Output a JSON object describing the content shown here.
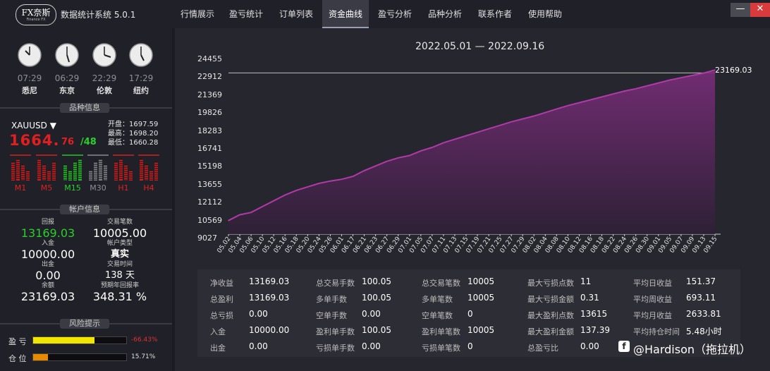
{
  "app": {
    "logo_main": "FX奈斯",
    "logo_sub": "Finance FX",
    "title": "数据统计系统 5.0.1"
  },
  "nav": {
    "tabs": [
      "行情展示",
      "盈亏统计",
      "订单列表",
      "资金曲线",
      "盈亏分析",
      "品种分析",
      "联系作者",
      "使用帮助"
    ],
    "active": 3
  },
  "window": {
    "minimize": "—",
    "close": "✕"
  },
  "clocks": [
    {
      "time": "07:29",
      "city": "悉尼"
    },
    {
      "time": "06:29",
      "city": "东京"
    },
    {
      "time": "22:29",
      "city": "伦敦"
    },
    {
      "time": "17:29",
      "city": "纽约"
    }
  ],
  "instrument": {
    "section_title": "品种信息",
    "symbol": "XAUUSD",
    "price_main": "1664.",
    "price_frac": "76",
    "price_sep": "/48",
    "open": "开盘：1697.59",
    "high": "最高：1698.20",
    "low": "最低：1660.28",
    "timeframes": [
      {
        "label": "M1",
        "color": "#e02020"
      },
      {
        "label": "M5",
        "color": "#e02020"
      },
      {
        "label": "M15",
        "color": "#2ad02a"
      },
      {
        "label": "M30",
        "color": "#8f8f96"
      },
      {
        "label": "H1",
        "color": "#e02020"
      },
      {
        "label": "H4",
        "color": "#e02020"
      }
    ]
  },
  "account": {
    "section_title": "帐户信息",
    "return_label": "回报",
    "return_value": "13169.03",
    "deposit_label": "入金",
    "deposit_value": "10000.00",
    "withdraw_label": "出金",
    "withdraw_value": "0.00",
    "balance_label": "余额",
    "balance_value": "23169.03",
    "trades_label": "交易笔数",
    "trades_value": "10005.00",
    "type_label": "帐户类型",
    "type_value": "真实",
    "time_label": "交易时间",
    "time_value": "138 天",
    "annual_label": "预期年回报率",
    "annual_value": "348.31 %"
  },
  "risk": {
    "section_title": "风险提示",
    "pl_label": "盈 亏",
    "pl_value": "-66.43%",
    "pl_fill": 0.66,
    "pl_color": "#f2e600",
    "pl_text_color": "#e03030",
    "pos_label": "仓 位",
    "pos_value": "15.71%",
    "pos_fill": 0.157,
    "pos_color": "#e88a00",
    "pos_text_color": "#e0e0e0"
  },
  "chart_data": {
    "type": "area",
    "title": "2022.05.01 — 2022.09.16",
    "y_ticks": [
      "24455",
      "22912",
      "21369",
      "19826",
      "18283",
      "16741",
      "15198",
      "13655",
      "12112",
      "10569",
      "9027"
    ],
    "ylim": [
      9027,
      24455
    ],
    "x_ticks": [
      "05.02",
      "05.04",
      "05.06",
      "05.10",
      "05.12",
      "05.16",
      "05.18",
      "05.20",
      "05.24",
      "05.26",
      "06.01",
      "06.17",
      "06.21",
      "06.23",
      "06.27",
      "06.29",
      "07.01",
      "07.05",
      "07.07",
      "07.11",
      "07.13",
      "07.15",
      "07.19",
      "07.21",
      "07.25",
      "07.27",
      "07.29",
      "08.02",
      "08.04",
      "08.08",
      "08.10",
      "08.12",
      "08.16",
      "08.18",
      "08.22",
      "08.24",
      "08.26",
      "08.30",
      "09.01",
      "09.05",
      "09.07",
      "09.09",
      "09.13",
      "09.15"
    ],
    "values": [
      10200,
      10700,
      10900,
      11400,
      11900,
      12400,
      12800,
      13100,
      13400,
      13600,
      13750,
      14000,
      14500,
      14900,
      15300,
      15600,
      15800,
      16200,
      16500,
      16900,
      17200,
      17500,
      17800,
      18100,
      18400,
      18700,
      18950,
      19200,
      19500,
      19800,
      20100,
      20350,
      20600,
      20850,
      21100,
      21350,
      21550,
      21800,
      22050,
      22300,
      22500,
      22700,
      22900,
      23169.03
    ],
    "end_label": "23169.03",
    "line_color": "#b03aa8",
    "fill_top": "#7a2d7a",
    "fill_bottom": "#2e2036",
    "ref_line": 22912
  },
  "stats": {
    "col1": [
      [
        "净收益",
        "13169.03"
      ],
      [
        "总盈利",
        "13169.03"
      ],
      [
        "总亏损",
        "0.00"
      ],
      [
        "入金",
        "10000.00"
      ],
      [
        "出金",
        "0.00"
      ]
    ],
    "col2": [
      [
        "总交易手数",
        "100.05"
      ],
      [
        "多单手数",
        "100.05"
      ],
      [
        "空单手数",
        "0.00"
      ],
      [
        "盈利单手数",
        "100.05"
      ],
      [
        "亏损单手数",
        "0.00"
      ]
    ],
    "col3": [
      [
        "总交易笔数",
        "10005"
      ],
      [
        "多单笔数",
        "10005"
      ],
      [
        "空单笔数",
        "0"
      ],
      [
        "盈利单笔数",
        "10005"
      ],
      [
        "亏损单笔数",
        "0"
      ]
    ],
    "col4": [
      [
        "最大亏损点数",
        "11"
      ],
      [
        "最大亏损金额",
        "0.31"
      ],
      [
        "最大盈利点数",
        "13615"
      ],
      [
        "最大盈利金额",
        "137.39"
      ],
      [
        "总盈亏比",
        "0.00"
      ]
    ],
    "col5": [
      [
        "平均日收益",
        "151.37"
      ],
      [
        "平均周收益",
        "693.11"
      ],
      [
        "平均月收益",
        "2633.81"
      ],
      [
        "平均持仓时间",
        "5.48小时"
      ],
      [
        "",
        ""
      ]
    ]
  },
  "watermark": {
    "text": "@Hardison（拖拉机）",
    "icon": "f"
  }
}
